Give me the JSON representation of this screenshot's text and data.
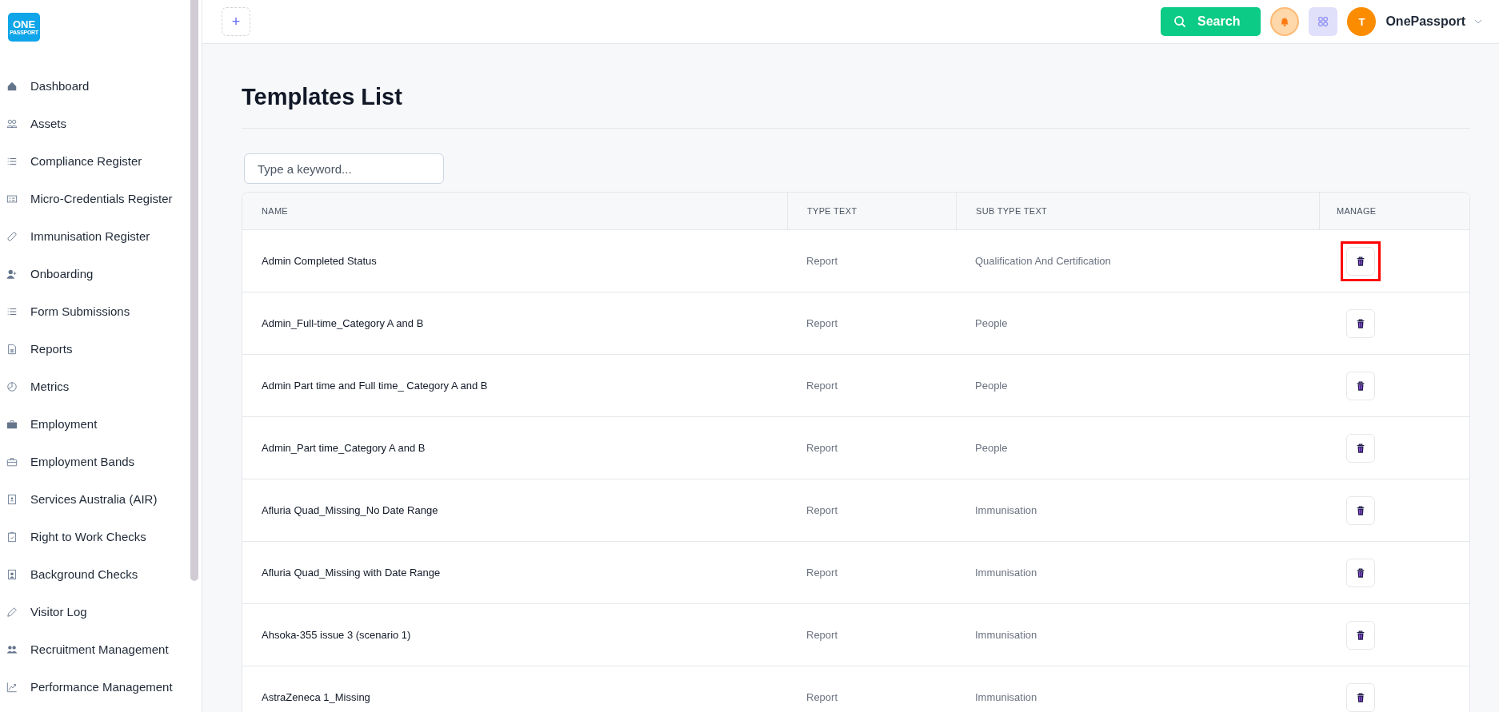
{
  "logo": {
    "line1": "ONE",
    "line2": "PASSPORT"
  },
  "sidebar": {
    "items": [
      {
        "label": "Dashboard",
        "kind": "house"
      },
      {
        "label": "Assets",
        "kind": "people"
      },
      {
        "label": "Compliance Register",
        "kind": "list"
      },
      {
        "label": "Micro-Credentials Register",
        "kind": "card"
      },
      {
        "label": "Immunisation Register",
        "kind": "bandage"
      },
      {
        "label": "Onboarding",
        "kind": "user-plus"
      },
      {
        "label": "Form Submissions",
        "kind": "list"
      },
      {
        "label": "Reports",
        "kind": "document"
      },
      {
        "label": "Metrics",
        "kind": "pie"
      },
      {
        "label": "Employment",
        "kind": "briefcase-solid"
      },
      {
        "label": "Employment Bands",
        "kind": "briefcase"
      },
      {
        "label": "Services Australia (AIR)",
        "kind": "badge"
      },
      {
        "label": "Right to Work Checks",
        "kind": "clipboard"
      },
      {
        "label": "Background Checks",
        "kind": "person-doc"
      },
      {
        "label": "Visitor Log",
        "kind": "pencil"
      },
      {
        "label": "Recruitment Management",
        "kind": "people-solid"
      },
      {
        "label": "Performance Management",
        "kind": "trend"
      }
    ]
  },
  "topbar": {
    "add_button": "+",
    "search_button": "Search",
    "avatar_initial": "T",
    "account_name": "OnePassport"
  },
  "page": {
    "title": "Templates List",
    "search": {
      "placeholder": "Type a keyword..."
    }
  },
  "table": {
    "columns": [
      "NAME",
      "TYPE TEXT",
      "SUB TYPE TEXT",
      "MANAGE"
    ],
    "rows": [
      {
        "name": "Admin Completed Status",
        "type": "Report",
        "sub_type": "Qualification And Certification",
        "highlighted": true
      },
      {
        "name": "Admin_Full-time_Category A and B",
        "type": "Report",
        "sub_type": "People",
        "highlighted": false
      },
      {
        "name": "Admin Part time and Full time_ Category A and B",
        "type": "Report",
        "sub_type": "People",
        "highlighted": false
      },
      {
        "name": "Admin_Part time_Category A and B",
        "type": "Report",
        "sub_type": "People",
        "highlighted": false
      },
      {
        "name": "Afluria Quad_Missing_No Date Range",
        "type": "Report",
        "sub_type": "Immunisation",
        "highlighted": false
      },
      {
        "name": "Afluria Quad_Missing with Date Range",
        "type": "Report",
        "sub_type": "Immunisation",
        "highlighted": false
      },
      {
        "name": "Ahsoka-355 issue 3 (scenario 1)",
        "type": "Report",
        "sub_type": "Immunisation",
        "highlighted": false
      },
      {
        "name": "AstraZeneca 1_Missing",
        "type": "Report",
        "sub_type": "Immunisation",
        "highlighted": false
      }
    ]
  }
}
